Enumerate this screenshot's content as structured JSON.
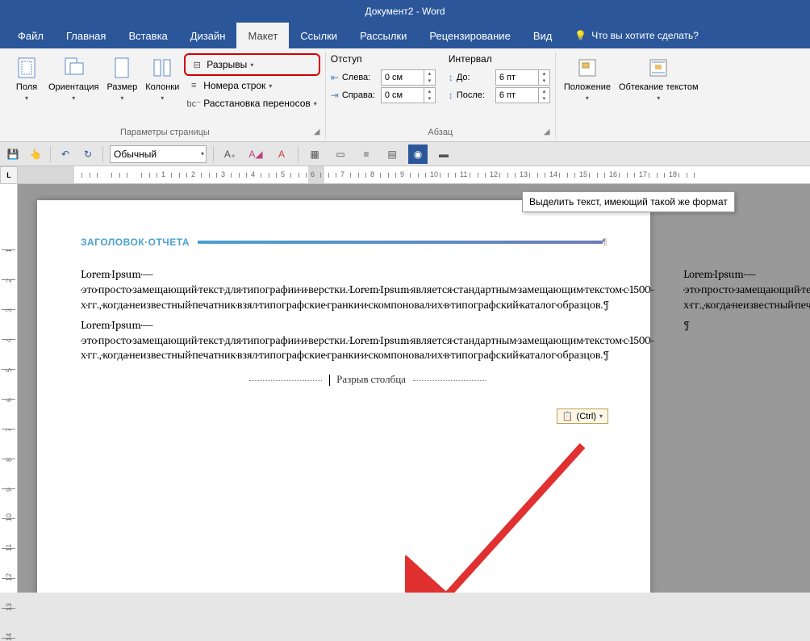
{
  "app": {
    "title": "Документ2 - Word"
  },
  "tabs": {
    "file": "Файл",
    "home": "Главная",
    "insert": "Вставка",
    "design": "Дизайн",
    "layout": "Макет",
    "references": "Ссылки",
    "mailings": "Рассылки",
    "review": "Рецензирование",
    "view": "Вид",
    "tell_me": "Что вы хотите сделать?"
  },
  "ribbon": {
    "margins": "Поля",
    "orientation": "Ориентация",
    "size": "Размер",
    "columns": "Колонки",
    "breaks": "Разрывы",
    "line_numbers": "Номера строк",
    "hyphenation": "Расстановка переносов",
    "page_setup_group": "Параметры страницы",
    "indent": "Отступ",
    "left_label": "Слева:",
    "right_label": "Справа:",
    "left_value": "0 см",
    "right_value": "0 см",
    "spacing": "Интервал",
    "before_label": "До:",
    "after_label": "После:",
    "before_value": "6 пт",
    "after_value": "6 пт",
    "paragraph_group": "Абзац",
    "position": "Положение",
    "wrap_text": "Обтекание текстом"
  },
  "qat": {
    "style": "Обычный"
  },
  "tooltip": "Выделить текст, имеющий такой же формат",
  "vruler_corner": "L",
  "doc": {
    "heading": "ЗАГОЛОВОК·ОТЧЕТА",
    "para": "Lorem·Ipsum·—·это·просто·замещающий·текст·для·типографии·и·верстки.·Lorem·Ipsum·является·стандартным·замещающим·текстом·с·1500-х·гг.,·когда·неизвестный·печатник·взял·типографские·гранки·и·скомпоновал·их·в·типографский·каталог·образцов.¶",
    "column_break": "Разрыв столбца",
    "paste_ctrl": "(Ctrl)",
    "solo_pilcrow": "¶"
  }
}
